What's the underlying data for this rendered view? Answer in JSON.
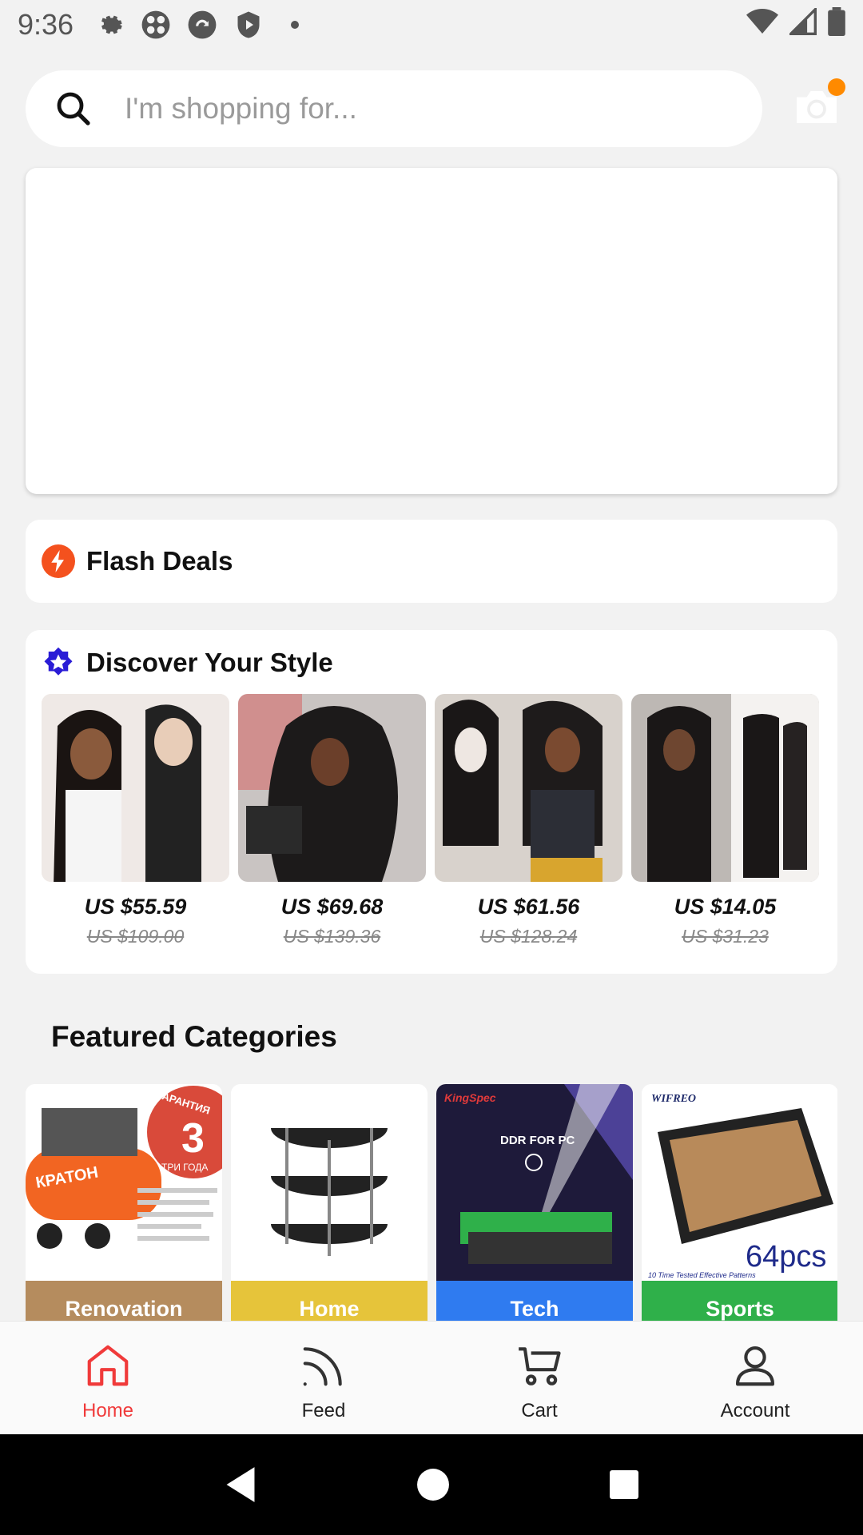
{
  "status_bar": {
    "time": "9:36",
    "icons_left": [
      "gear-icon",
      "fan-icon",
      "sync-icon",
      "shield-icon",
      "dot-icon"
    ],
    "icons_right": [
      "wifi-icon",
      "signal-icon",
      "battery-icon"
    ]
  },
  "search": {
    "placeholder": "I'm shopping for...",
    "camera_badge_color": "#ff8a00"
  },
  "flash_deals": {
    "title": "Flash Deals",
    "icon": "lightning-icon",
    "icon_color": "#f4511e"
  },
  "discover": {
    "title": "Discover Your Style",
    "icon": "star-badge-icon",
    "icon_color": "#2a1cd6",
    "products": [
      {
        "price": "US $55.59",
        "old_price": "US $109.00"
      },
      {
        "price": "US $69.68",
        "old_price": "US $139.36"
      },
      {
        "price": "US $61.56",
        "old_price": "US $128.24"
      },
      {
        "price": "US $14.05",
        "old_price": "US $31.23"
      }
    ]
  },
  "featured": {
    "title": "Featured Categories",
    "categories": [
      {
        "label": "Renovation",
        "color": "#b58c5e"
      },
      {
        "label": "Home",
        "color": "#e6c43a"
      },
      {
        "label": "Tech",
        "color": "#2f7bf0"
      },
      {
        "label": "Sports",
        "color": "#2fb04a"
      }
    ],
    "image_text": {
      "tech_brand": "KingSpec",
      "tech_caption": "DDR FOR PC",
      "sports_brand": "WIFREO",
      "sports_count": "64pcs",
      "sports_tagline": "10 Time Tested Effective Patterns",
      "renovation_brand": "КРАТОН",
      "renovation_badge_number": "3",
      "renovation_badge_text": "ТРИ ГОДА",
      "renovation_badge_arc": "ГАРАНТИЯ"
    }
  },
  "bottom_nav": {
    "items": [
      {
        "label": "Home",
        "icon": "home-icon",
        "active": true
      },
      {
        "label": "Feed",
        "icon": "feed-icon",
        "active": false
      },
      {
        "label": "Cart",
        "icon": "cart-icon",
        "active": false
      },
      {
        "label": "Account",
        "icon": "account-icon",
        "active": false
      }
    ],
    "active_color": "#f03a3a"
  },
  "system_nav": [
    "back-icon",
    "home-circle-icon",
    "recents-icon"
  ]
}
